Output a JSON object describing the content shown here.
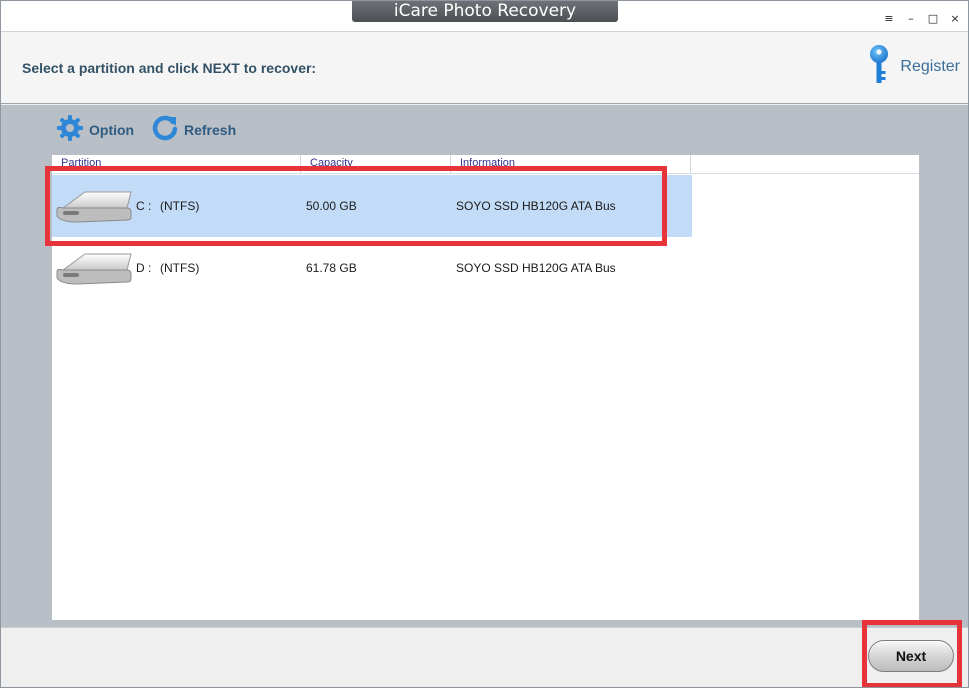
{
  "app": {
    "title": "iCare Photo Recovery"
  },
  "window_controls": {
    "menu": "≡",
    "minimize": "–",
    "maximize": "□",
    "close": "×"
  },
  "header": {
    "instruction": "Select a partition and click NEXT to recover:",
    "register_label": "Register"
  },
  "toolbar": {
    "option_label": "Option",
    "refresh_label": "Refresh"
  },
  "table": {
    "columns": [
      "Partition",
      "Capacity",
      "Information"
    ],
    "rows": [
      {
        "drive": "C :",
        "fs": "(NTFS)",
        "capacity": "50.00 GB",
        "info": "SOYO SSD HB120G  ATA Bus",
        "selected": true
      },
      {
        "drive": "D :",
        "fs": "(NTFS)",
        "capacity": "61.78 GB",
        "info": "SOYO SSD HB120G  ATA Bus",
        "selected": false
      }
    ]
  },
  "footer": {
    "next_label": "Next"
  },
  "colors": {
    "accent": "#2e5b82",
    "selection": "#c2dbf7",
    "highlight_annotation": "#e6343a",
    "panel_background": "#b8bfc6"
  },
  "icons": [
    "menu-icon",
    "key-icon",
    "gear-icon",
    "refresh-icon",
    "hard-drive-icon"
  ]
}
